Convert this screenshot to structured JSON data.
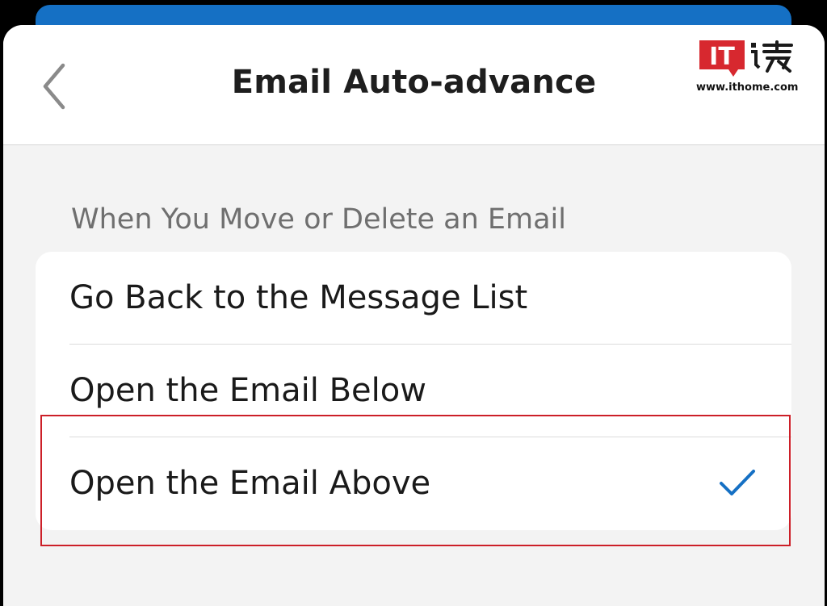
{
  "header": {
    "title": "Email Auto-advance",
    "back_icon": "chevron-left-icon"
  },
  "logo": {
    "mark_text": "IT",
    "url": "www.ithome.com"
  },
  "section": {
    "title": "When You Move or Delete an Email"
  },
  "options": [
    {
      "label": "Go Back to the Message List",
      "selected": false
    },
    {
      "label": "Open the Email Below",
      "selected": false
    },
    {
      "label": "Open the Email Above",
      "selected": true
    }
  ],
  "colors": {
    "accent": "#1570c4",
    "highlight": "#cc1f28",
    "logo_red": "#d7282f"
  }
}
